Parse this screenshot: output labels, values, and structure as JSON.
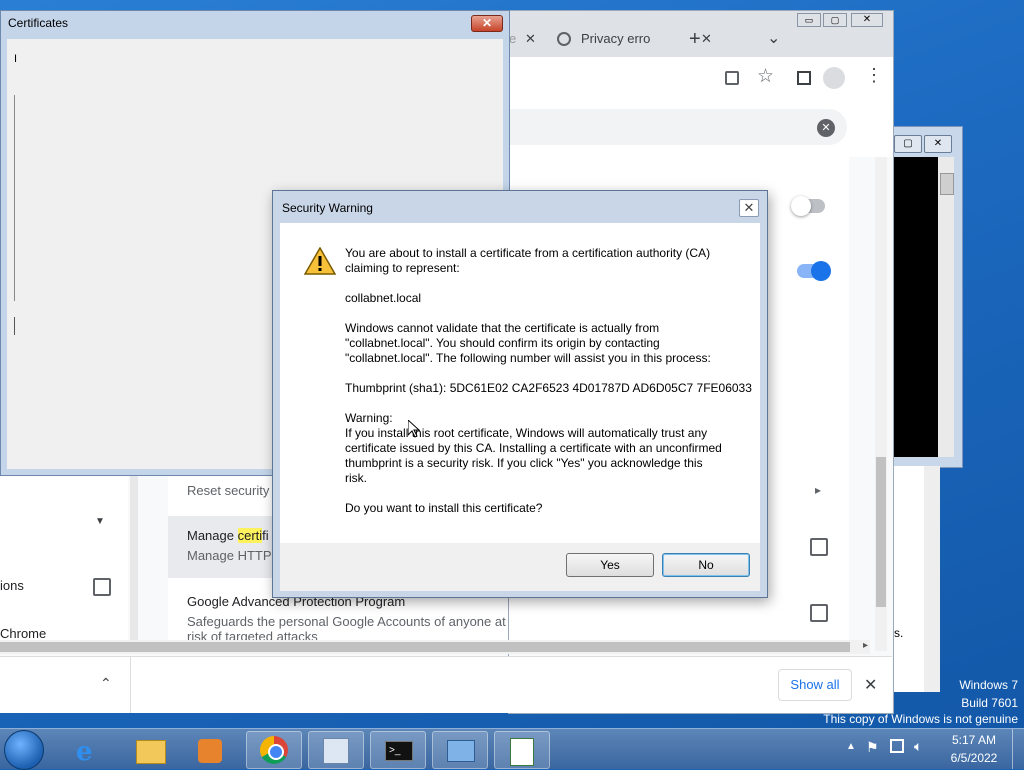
{
  "watermark": {
    "os": "Windows 7",
    "build": "Build 7601",
    "genuine": "This copy of Windows is not genuine"
  },
  "chrome": {
    "tabs": [
      {
        "label": "e",
        "close": "✕"
      },
      {
        "label": "Privacy erro",
        "close": "✕"
      }
    ],
    "new_tab": "+",
    "tab_menu": "⌄",
    "window_buttons": {
      "minimize": "▭",
      "maximize": "▢",
      "close": "✕"
    },
    "settings_rows": [
      {
        "title": "Reset security",
        "subtitle": ""
      },
      {
        "title_prefix": "Manage ",
        "title_highlight": "certi",
        "title_suffix": "fi",
        "subtitle": "Manage HTTP"
      },
      {
        "title": "Google Advanced Protection Program",
        "subtitle": "Safeguards the personal Google Accounts of anyone at risk of targeted attacks"
      }
    ],
    "left_items": [
      "ions",
      "Chrome"
    ],
    "download_bar": {
      "show_all": "Show all"
    },
    "highlight_color": "#fdf25d",
    "toggle_on_color": "#1a73e8"
  },
  "certificates": {
    "title": "Certificates",
    "close": "✕",
    "cursor_char": "I"
  },
  "dialog": {
    "title": "Security Warning",
    "close": "✕",
    "p1": "You are about to install a certificate from a certification authority (CA)\nclaiming to represent:",
    "p2": "collabnet.local",
    "p3": "Windows cannot validate that the certificate is actually from\n\"collabnet.local\". You should confirm its origin by contacting\n\"collabnet.local\". The following number will assist you in this process:",
    "p4": "Thumbprint (sha1): 5DC61E02 CA2F6523 4D01787D AD6D05C7 7FE06033",
    "p5": "Warning:\nIf you install this root certificate, Windows will automatically trust any\ncertificate issued by this CA. Installing a certificate with an unconfirmed\nthumbprint is a security risk. If you click \"Yes\" you acknowledge this\nrisk.",
    "p6": "Do you want to install this certificate?",
    "yes": "Yes",
    "no": "No"
  },
  "taskbar": {
    "apps": [
      "start-orb",
      "internet-explorer",
      "file-explorer",
      "media-player",
      "chrome",
      "certmgr",
      "command-prompt",
      "control-panel",
      "notepad"
    ],
    "time": "5:17 AM",
    "date": "6/5/2022",
    "tray_icons": [
      "show-hidden",
      "flag",
      "network",
      "volume"
    ]
  }
}
